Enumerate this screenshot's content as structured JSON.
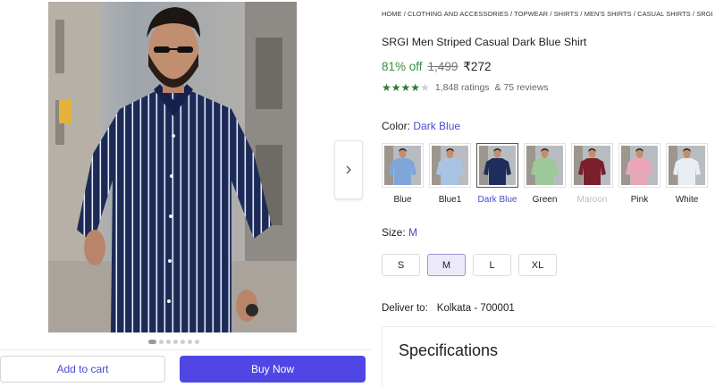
{
  "breadcrumb": [
    "HOME",
    "CLOTHING AND ACCESSORIES",
    "TOPWEAR",
    "SHIRTS",
    "MEN'S SHIRTS",
    "CASUAL SHIRTS",
    "SRGI"
  ],
  "product": {
    "title": "SRGI Men Striped Casual Dark Blue Shirt",
    "discount": "81% off",
    "mrp": "1,499",
    "price": "₹272",
    "rating_stars": 4,
    "ratings_text": "1,848 ratings",
    "reviews_text": "& 75 reviews"
  },
  "color": {
    "label": "Color:",
    "selected": "Dark Blue",
    "options": [
      {
        "name": "Blue",
        "shirt": "#7ea6d8"
      },
      {
        "name": "Blue1",
        "shirt": "#a9c4e2"
      },
      {
        "name": "Dark Blue",
        "shirt": "#1f2d5c"
      },
      {
        "name": "Green",
        "shirt": "#9cc89a"
      },
      {
        "name": "Maroon",
        "shirt": "#7a1f2b"
      },
      {
        "name": "Pink",
        "shirt": "#e8a6b8"
      },
      {
        "name": "White",
        "shirt": "#e9eef5"
      }
    ]
  },
  "size": {
    "label": "Size:",
    "selected": "M",
    "options": [
      "S",
      "M",
      "L",
      "XL"
    ]
  },
  "delivery": {
    "label": "Deliver to:",
    "location": "Kolkata - 700001"
  },
  "specifications_title": "Specifications",
  "actions": {
    "add_to_cart": "Add to cart",
    "buy_now": "Buy Now"
  },
  "gallery": {
    "image_count": 7,
    "active_index": 0
  },
  "colors": {
    "accent": "#4f46e5",
    "discount_green": "#388e3c",
    "star_green": "#2e7d32"
  },
  "icons": {
    "next": "chevron-right-icon",
    "star": "star-icon"
  }
}
